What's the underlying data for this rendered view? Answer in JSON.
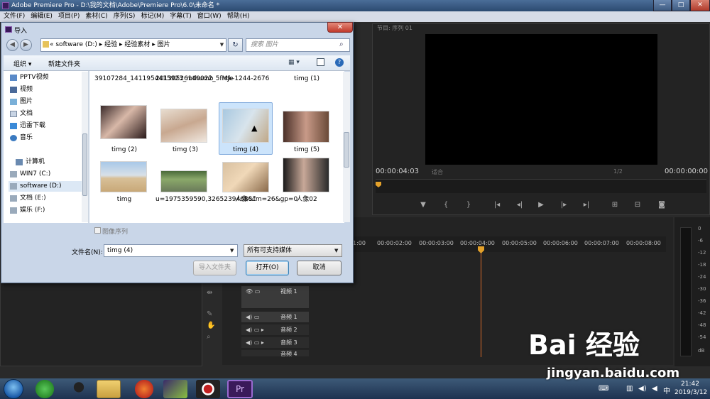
{
  "window": {
    "title": "Adobe Premiere Pro - D:\\我的文档\\Adobe\\Premiere Pro\\6.0\\未命名 *",
    "minimize": "—",
    "maximize": "□",
    "close": "✕"
  },
  "menu": [
    "文件(F)",
    "编辑(E)",
    "项目(P)",
    "素材(C)",
    "序列(S)",
    "标记(M)",
    "字幕(T)",
    "窗口(W)",
    "帮助(H)"
  ],
  "program_monitor": {
    "tab": "节目: 序列 01",
    "timecode_left": "00:00:04:03",
    "fit": "适合",
    "ratio": "1/2",
    "timecode_right": "00:00:00:00"
  },
  "timeline": {
    "ticks": [
      "1:00",
      "00:00:02:00",
      "00:00:03:00",
      "00:00:04:00",
      "00:00:05:00",
      "00:00:06:00",
      "00:00:07:00",
      "00:00:08:00"
    ],
    "tracks": [
      "视频 1",
      "音频 1",
      "音频 2",
      "音频 3",
      "音频 4"
    ]
  },
  "meter_db": [
    "0",
    "-6",
    "-12",
    "-18",
    "-24",
    "-30",
    "-36",
    "-42",
    "-48",
    "-54",
    "dB"
  ],
  "dialog": {
    "title": "导入",
    "close": "✕",
    "address": "« software (D:) ▸ 经验 ▸ 经验素材 ▸ 图片",
    "search_placeholder": "搜索 图片",
    "organize": "组织 ▾",
    "new_folder": "新建文件夹",
    "view": "▦ ▾",
    "help": "?",
    "nav": [
      "PPTV视频",
      "视频",
      "图片",
      "文档",
      "迅雷下载",
      "音乐",
      "计算机",
      "WIN7 (C:)",
      "software (D:)",
      "文档 (E:)",
      "娱乐 (F:)"
    ],
    "files": [
      "39107284_1411954415923_mthumb",
      "20130526140022_5fMJe",
      "ntk-1244-2676",
      "timg (1)",
      "timg (2)",
      "timg (3)",
      "timg (4)",
      "timg (5)",
      "timg",
      "u=1975359590,3265239468&fm=26&gp=0",
      "人像01",
      "人像02"
    ],
    "image_sequence": "图像序列",
    "filename_label": "文件名(N):",
    "filename_value": "timg (4)",
    "filter": "所有可支持媒体",
    "btn_import_folder": "导入文件夹",
    "btn_open": "打开(O)",
    "btn_cancel": "取消"
  },
  "taskbar": {
    "time": "21:42",
    "date": "2019/3/12"
  },
  "watermark": {
    "logo": "Bai 经验",
    "url": "jingyan.baidu.com"
  },
  "colors": {
    "accent": "#e4a12a",
    "selection": "#cce4fb",
    "titlebar": "#2c4a70"
  }
}
